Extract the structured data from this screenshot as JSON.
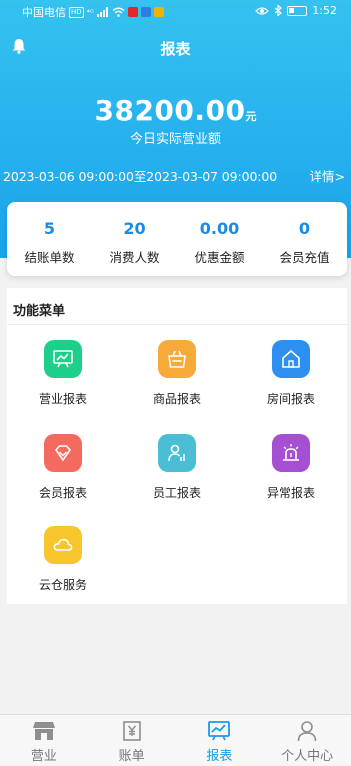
{
  "status_bar": {
    "carrier": "中国电信",
    "hd_badge": "HD",
    "network": "⁴ᴳ",
    "time": "1:52",
    "app_icon_colors": [
      "#e2262b",
      "#2f7de0",
      "#f0b400"
    ]
  },
  "header": {
    "title": "报表",
    "bell_icon": "bell-icon"
  },
  "summary": {
    "amount": "38200.00",
    "unit": "元",
    "label": "今日实际营业额",
    "range_start": "2023-03-06 09:00:00",
    "range_sep": "至",
    "range_end": "2023-03-07 09:00:00",
    "detail_link": "详情>"
  },
  "stats": [
    {
      "value": "5",
      "label": "结账单数"
    },
    {
      "value": "20",
      "label": "消费人数"
    },
    {
      "value": "0.00",
      "label": "优惠金额"
    },
    {
      "value": "0",
      "label": "会员充值"
    }
  ],
  "menu": {
    "title": "功能菜单",
    "items": [
      {
        "label": "营业报表",
        "icon": "business-report-icon",
        "color": "#1ecf8c"
      },
      {
        "label": "商品报表",
        "icon": "product-bag-icon",
        "color": "#f7a93a"
      },
      {
        "label": "房间报表",
        "icon": "room-house-icon",
        "color": "#2d8ff0"
      },
      {
        "label": "会员报表",
        "icon": "member-diamond-icon",
        "color": "#f46a5e"
      },
      {
        "label": "员工报表",
        "icon": "staff-icon",
        "color": "#4bbed5"
      },
      {
        "label": "异常报表",
        "icon": "alarm-light-icon",
        "color": "#a54fd2"
      },
      {
        "label": "云仓服务",
        "icon": "cloud-icon",
        "color": "#f7c52c"
      }
    ]
  },
  "tabs": [
    {
      "label": "营业",
      "icon": "store-icon",
      "active": false
    },
    {
      "label": "账单",
      "icon": "yuan-bill-icon",
      "active": false
    },
    {
      "label": "报表",
      "icon": "report-chart-icon",
      "active": true
    },
    {
      "label": "个人中心",
      "icon": "user-icon",
      "active": false
    }
  ],
  "colors": {
    "header_gradient_top": "#35c2ef",
    "header_gradient_bottom": "#1aa3ec",
    "stat_value": "#1b8be6",
    "tab_active": "#1a9be8"
  }
}
